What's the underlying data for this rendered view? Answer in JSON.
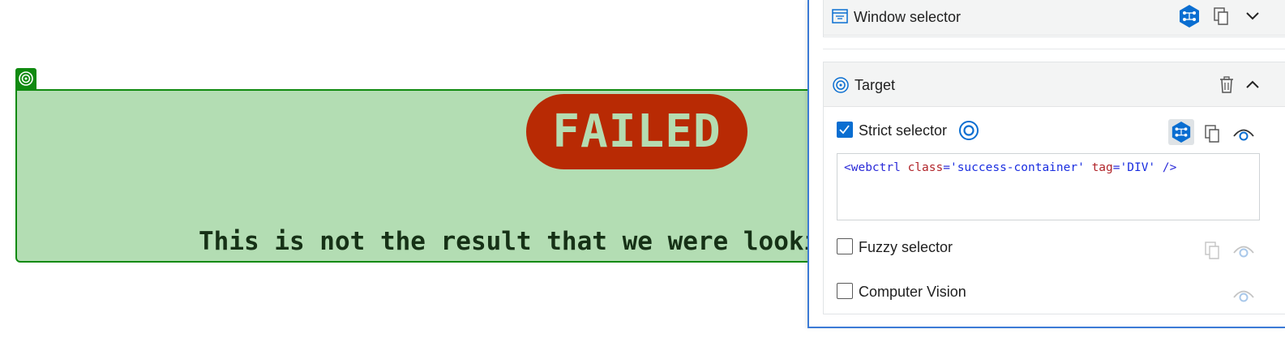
{
  "page": {
    "badge_text": "FAILED",
    "message_text": "This is not the result that we were looki"
  },
  "panel": {
    "window_selector": {
      "title": "Window selector"
    },
    "target": {
      "title": "Target",
      "strict_selector": {
        "label": "Strict selector",
        "checked": true,
        "code": {
          "open": "<",
          "tag": "webctrl",
          "attr1_name": "class",
          "attr1_eq": "=",
          "attr1_value": "'success-container'",
          "attr2_name": "tag",
          "attr2_eq": "=",
          "attr2_value": "'DIV'",
          "close": "/>"
        }
      },
      "fuzzy_selector": {
        "label": "Fuzzy selector",
        "checked": false
      },
      "computer_vision": {
        "label": "Computer Vision",
        "checked": false
      }
    }
  },
  "colors": {
    "highlight_fill": "#b3ddb3",
    "highlight_border": "#108a10",
    "badge_fill": "#b82a04",
    "accent_blue": "#0a6ed1"
  },
  "icons": [
    "target-icon",
    "window-selector-icon",
    "hexagon-network-icon",
    "copy-icon",
    "chevron-down-icon",
    "chevron-up-icon",
    "trash-icon",
    "eye-icon",
    "check-icon"
  ]
}
